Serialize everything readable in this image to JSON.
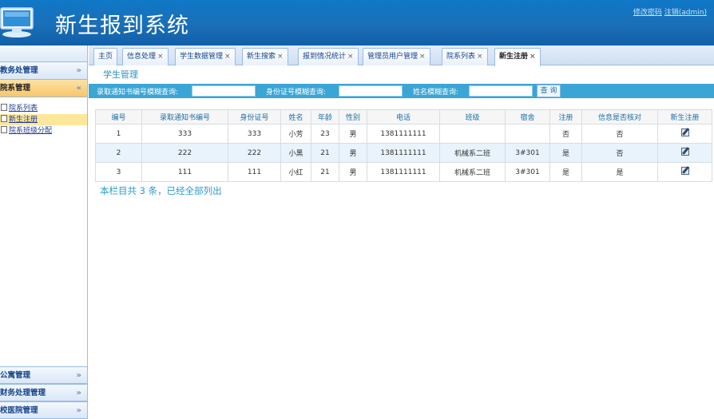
{
  "app": {
    "title": "新生报到系统",
    "change_password": "修改密码",
    "logout": "注销(admin)"
  },
  "sidebar": {
    "top_head": "教务处管理",
    "open_head": "院系管理",
    "links": [
      "院系列表",
      "新生注册",
      "院系班级分配"
    ],
    "bottom_heads": [
      "公寓管理",
      "财务处理管理",
      "校医院管理"
    ]
  },
  "tabs": [
    "主页",
    "信息处理",
    "学生数据管理",
    "新生搜索",
    "报到情况统计",
    "管理员用户管理",
    "院系列表",
    "新生注册"
  ],
  "panel": {
    "title": "学生管理"
  },
  "search": {
    "label1": "录取通知书编号模糊查询:",
    "label2": "身份证号模糊查询:",
    "label3": "姓名模糊查询:",
    "button": "查 询"
  },
  "table": {
    "headers": [
      "编号",
      "录取通知书编号",
      "身份证号",
      "姓名",
      "年龄",
      "性别",
      "电话",
      "班级",
      "宿舍",
      "注册",
      "信息是否核对",
      "新生注册"
    ],
    "rows": [
      [
        "1",
        "333",
        "333",
        "小芳",
        "23",
        "男",
        "1381111111",
        "",
        "",
        "否",
        "否"
      ],
      [
        "2",
        "222",
        "222",
        "小黑",
        "21",
        "男",
        "1381111111",
        "机械系二班",
        "3#301",
        "是",
        "否"
      ],
      [
        "3",
        "111",
        "111",
        "小红",
        "21",
        "男",
        "1381111111",
        "机械系二班",
        "3#301",
        "是",
        "是"
      ]
    ]
  },
  "summary": "本栏目共 3 条，已经全部列出"
}
